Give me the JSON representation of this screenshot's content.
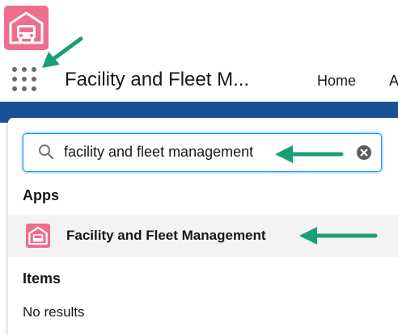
{
  "app": {
    "logo_icon": "garage-car-icon",
    "logo_color": "#ee6e8b",
    "name": "Facility and Fleet M..."
  },
  "nav": {
    "launcher_icon": "app-launcher-waffle-icon",
    "tabs": [
      "Home",
      "A"
    ]
  },
  "launcher": {
    "search": {
      "value": "facility and fleet management",
      "placeholder": "",
      "search_icon": "search-icon",
      "clear_icon": "clear-icon"
    },
    "sections": {
      "apps_title": "Apps",
      "items_title": "Items"
    },
    "apps": [
      {
        "label": "Facility and Fleet Management",
        "icon": "garage-car-icon"
      }
    ],
    "items_empty_text": "No results"
  },
  "annotations": {
    "arrow_color": "#1a9e78"
  },
  "colors": {
    "focus_border": "#1b96ff",
    "header_band": "#1b5297",
    "hover_row": "#f3f3f3"
  }
}
